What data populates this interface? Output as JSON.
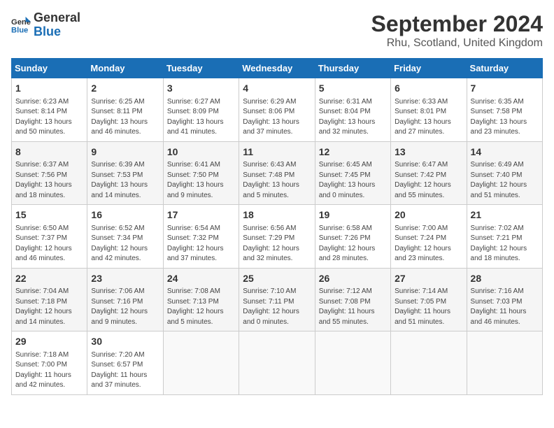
{
  "logo": {
    "general": "General",
    "blue": "Blue"
  },
  "title": "September 2024",
  "subtitle": "Rhu, Scotland, United Kingdom",
  "days_of_week": [
    "Sunday",
    "Monday",
    "Tuesday",
    "Wednesday",
    "Thursday",
    "Friday",
    "Saturday"
  ],
  "weeks": [
    [
      {
        "num": "1",
        "info": "Sunrise: 6:23 AM\nSunset: 8:14 PM\nDaylight: 13 hours\nand 50 minutes."
      },
      {
        "num": "2",
        "info": "Sunrise: 6:25 AM\nSunset: 8:11 PM\nDaylight: 13 hours\nand 46 minutes."
      },
      {
        "num": "3",
        "info": "Sunrise: 6:27 AM\nSunset: 8:09 PM\nDaylight: 13 hours\nand 41 minutes."
      },
      {
        "num": "4",
        "info": "Sunrise: 6:29 AM\nSunset: 8:06 PM\nDaylight: 13 hours\nand 37 minutes."
      },
      {
        "num": "5",
        "info": "Sunrise: 6:31 AM\nSunset: 8:04 PM\nDaylight: 13 hours\nand 32 minutes."
      },
      {
        "num": "6",
        "info": "Sunrise: 6:33 AM\nSunset: 8:01 PM\nDaylight: 13 hours\nand 27 minutes."
      },
      {
        "num": "7",
        "info": "Sunrise: 6:35 AM\nSunset: 7:58 PM\nDaylight: 13 hours\nand 23 minutes."
      }
    ],
    [
      {
        "num": "8",
        "info": "Sunrise: 6:37 AM\nSunset: 7:56 PM\nDaylight: 13 hours\nand 18 minutes."
      },
      {
        "num": "9",
        "info": "Sunrise: 6:39 AM\nSunset: 7:53 PM\nDaylight: 13 hours\nand 14 minutes."
      },
      {
        "num": "10",
        "info": "Sunrise: 6:41 AM\nSunset: 7:50 PM\nDaylight: 13 hours\nand 9 minutes."
      },
      {
        "num": "11",
        "info": "Sunrise: 6:43 AM\nSunset: 7:48 PM\nDaylight: 13 hours\nand 5 minutes."
      },
      {
        "num": "12",
        "info": "Sunrise: 6:45 AM\nSunset: 7:45 PM\nDaylight: 13 hours\nand 0 minutes."
      },
      {
        "num": "13",
        "info": "Sunrise: 6:47 AM\nSunset: 7:42 PM\nDaylight: 12 hours\nand 55 minutes."
      },
      {
        "num": "14",
        "info": "Sunrise: 6:49 AM\nSunset: 7:40 PM\nDaylight: 12 hours\nand 51 minutes."
      }
    ],
    [
      {
        "num": "15",
        "info": "Sunrise: 6:50 AM\nSunset: 7:37 PM\nDaylight: 12 hours\nand 46 minutes."
      },
      {
        "num": "16",
        "info": "Sunrise: 6:52 AM\nSunset: 7:34 PM\nDaylight: 12 hours\nand 42 minutes."
      },
      {
        "num": "17",
        "info": "Sunrise: 6:54 AM\nSunset: 7:32 PM\nDaylight: 12 hours\nand 37 minutes."
      },
      {
        "num": "18",
        "info": "Sunrise: 6:56 AM\nSunset: 7:29 PM\nDaylight: 12 hours\nand 32 minutes."
      },
      {
        "num": "19",
        "info": "Sunrise: 6:58 AM\nSunset: 7:26 PM\nDaylight: 12 hours\nand 28 minutes."
      },
      {
        "num": "20",
        "info": "Sunrise: 7:00 AM\nSunset: 7:24 PM\nDaylight: 12 hours\nand 23 minutes."
      },
      {
        "num": "21",
        "info": "Sunrise: 7:02 AM\nSunset: 7:21 PM\nDaylight: 12 hours\nand 18 minutes."
      }
    ],
    [
      {
        "num": "22",
        "info": "Sunrise: 7:04 AM\nSunset: 7:18 PM\nDaylight: 12 hours\nand 14 minutes."
      },
      {
        "num": "23",
        "info": "Sunrise: 7:06 AM\nSunset: 7:16 PM\nDaylight: 12 hours\nand 9 minutes."
      },
      {
        "num": "24",
        "info": "Sunrise: 7:08 AM\nSunset: 7:13 PM\nDaylight: 12 hours\nand 5 minutes."
      },
      {
        "num": "25",
        "info": "Sunrise: 7:10 AM\nSunset: 7:11 PM\nDaylight: 12 hours\nand 0 minutes."
      },
      {
        "num": "26",
        "info": "Sunrise: 7:12 AM\nSunset: 7:08 PM\nDaylight: 11 hours\nand 55 minutes."
      },
      {
        "num": "27",
        "info": "Sunrise: 7:14 AM\nSunset: 7:05 PM\nDaylight: 11 hours\nand 51 minutes."
      },
      {
        "num": "28",
        "info": "Sunrise: 7:16 AM\nSunset: 7:03 PM\nDaylight: 11 hours\nand 46 minutes."
      }
    ],
    [
      {
        "num": "29",
        "info": "Sunrise: 7:18 AM\nSunset: 7:00 PM\nDaylight: 11 hours\nand 42 minutes."
      },
      {
        "num": "30",
        "info": "Sunrise: 7:20 AM\nSunset: 6:57 PM\nDaylight: 11 hours\nand 37 minutes."
      },
      {
        "num": "",
        "info": ""
      },
      {
        "num": "",
        "info": ""
      },
      {
        "num": "",
        "info": ""
      },
      {
        "num": "",
        "info": ""
      },
      {
        "num": "",
        "info": ""
      }
    ]
  ]
}
